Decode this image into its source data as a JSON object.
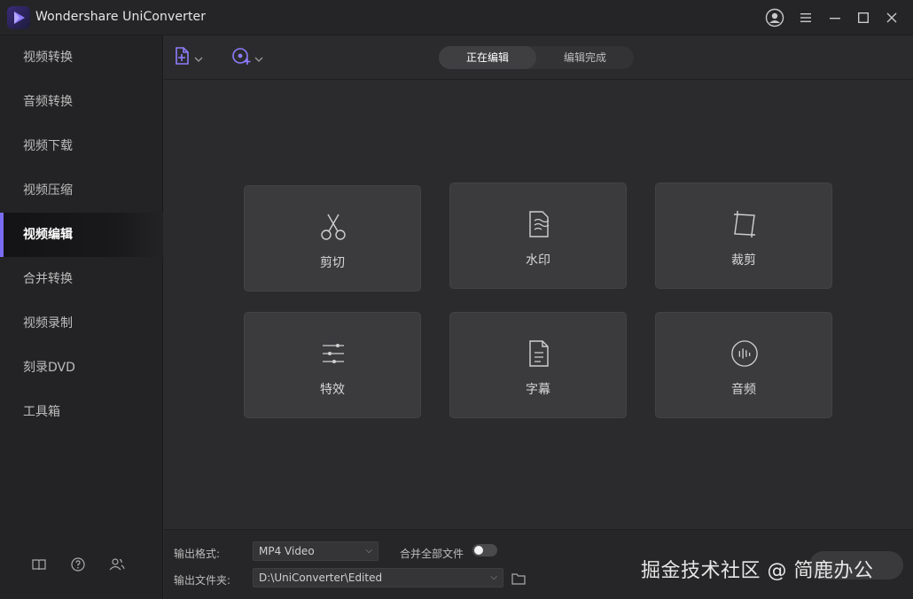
{
  "app": {
    "title": "Wondershare UniConverter"
  },
  "titlebar": {
    "account_icon": "user-circle-icon",
    "menu_icon": "hamburger-icon",
    "minimize_icon": "minimize-icon",
    "maximize_icon": "maximize-icon",
    "close_icon": "close-icon"
  },
  "sidebar": {
    "items": [
      {
        "label": "视频转换"
      },
      {
        "label": "音频转换"
      },
      {
        "label": "视频下载"
      },
      {
        "label": "视频压缩"
      },
      {
        "label": "视频编辑",
        "active": true
      },
      {
        "label": "合并转换"
      },
      {
        "label": "视频录制"
      },
      {
        "label": "刻录DVD"
      },
      {
        "label": "工具箱"
      }
    ],
    "footer_icons": [
      "book-icon",
      "help-icon",
      "people-icon"
    ]
  },
  "toolbar": {
    "add_file_icon": "add-file-icon",
    "add_media_icon": "add-media-icon",
    "tabs": [
      {
        "label": "正在编辑",
        "active": true
      },
      {
        "label": "编辑完成"
      }
    ]
  },
  "tools": [
    {
      "label": "剪切",
      "icon": "scissors-icon"
    },
    {
      "label": "水印",
      "icon": "watermark-icon"
    },
    {
      "label": "裁剪",
      "icon": "crop-icon"
    },
    {
      "label": "特效",
      "icon": "effects-sliders-icon"
    },
    {
      "label": "字幕",
      "icon": "subtitle-icon"
    },
    {
      "label": "音频",
      "icon": "audio-icon"
    }
  ],
  "bottom": {
    "output_format_label": "输出格式:",
    "output_format_value": "MP4 Video",
    "merge_label": "合并全部文件",
    "merge_enabled": false,
    "output_folder_label": "输出文件夹:",
    "output_folder_value": "D:\\UniConverter\\Edited",
    "watermark_text": "掘金技术社区 @ 简鹿办公"
  },
  "colors": {
    "accent": "#7b6cf6",
    "background": "#2b2b2d",
    "card": "#3b3b3e"
  }
}
